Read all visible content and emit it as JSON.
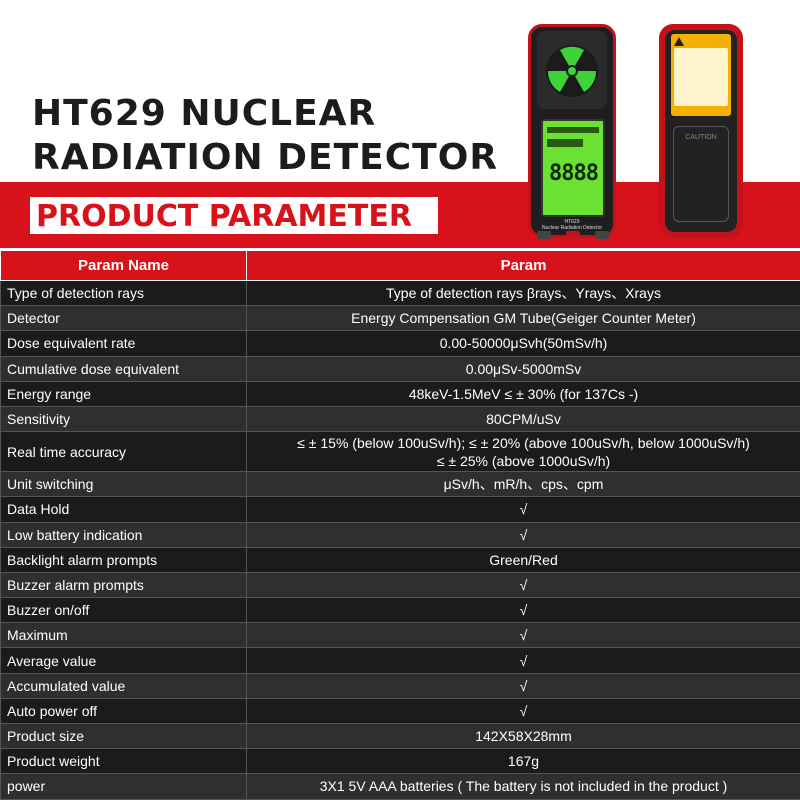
{
  "title": {
    "line1": "HT629 NUCLEAR",
    "line2": "RADIATION DETECTOR"
  },
  "banner": "PRODUCT PARAMETER",
  "device": {
    "model": "HT629",
    "subtitle": "Nuclear Radiation Detector",
    "display_digits": "8888",
    "caution": "CAUTION"
  },
  "table": {
    "headers": [
      "Param Name",
      "Param"
    ],
    "rows": [
      {
        "name": "Type of detection rays",
        "value": "Type of detection rays βrays、Yrays、Xrays"
      },
      {
        "name": "Detector",
        "value": "Energy Compensation GM Tube(Geiger Counter Meter)"
      },
      {
        "name": "Dose equivalent rate",
        "value": "0.00-50000μSvh(50mSv/h)"
      },
      {
        "name": "Cumulative dose equivalent",
        "value": "0.00μSv-5000mSv"
      },
      {
        "name": "Energy range",
        "value": "48keV-1.5MeV ≤ ± 30% (for 137Cs -)"
      },
      {
        "name": "Sensitivity",
        "value": "80CPM/uSv"
      },
      {
        "name": "Real time accuracy",
        "value": "≤ ± 15% (below 100uSv/h); ≤ ± 20% (above 100uSv/h, below 1000uSv/h)",
        "value2": "≤ ± 25% (above 1000uSv/h)"
      },
      {
        "name": "Unit switching",
        "value": "μSv/h、mR/h、cps、cpm"
      },
      {
        "name": "Data Hold",
        "value": "√"
      },
      {
        "name": "Low battery indication",
        "value": "√"
      },
      {
        "name": "Backlight alarm prompts",
        "value": "Green/Red"
      },
      {
        "name": "Buzzer alarm prompts",
        "value": "√"
      },
      {
        "name": "Buzzer on/off",
        "value": "√"
      },
      {
        "name": "Maximum",
        "value": "√"
      },
      {
        "name": "Average value",
        "value": "√"
      },
      {
        "name": "Accumulated value",
        "value": "√"
      },
      {
        "name": "Auto power off",
        "value": "√"
      },
      {
        "name": "Product size",
        "value": "142X58X28mm"
      },
      {
        "name": "Product weight",
        "value": "167g"
      },
      {
        "name": "power",
        "value": "3X1 5V AAA batteries ( The battery is not included in the product )"
      }
    ]
  },
  "colors": {
    "accent_red": "#d8121a",
    "row_dark": "#1b1b1b",
    "row_light": "#2f2f2f",
    "screen_green": "#6be233"
  }
}
